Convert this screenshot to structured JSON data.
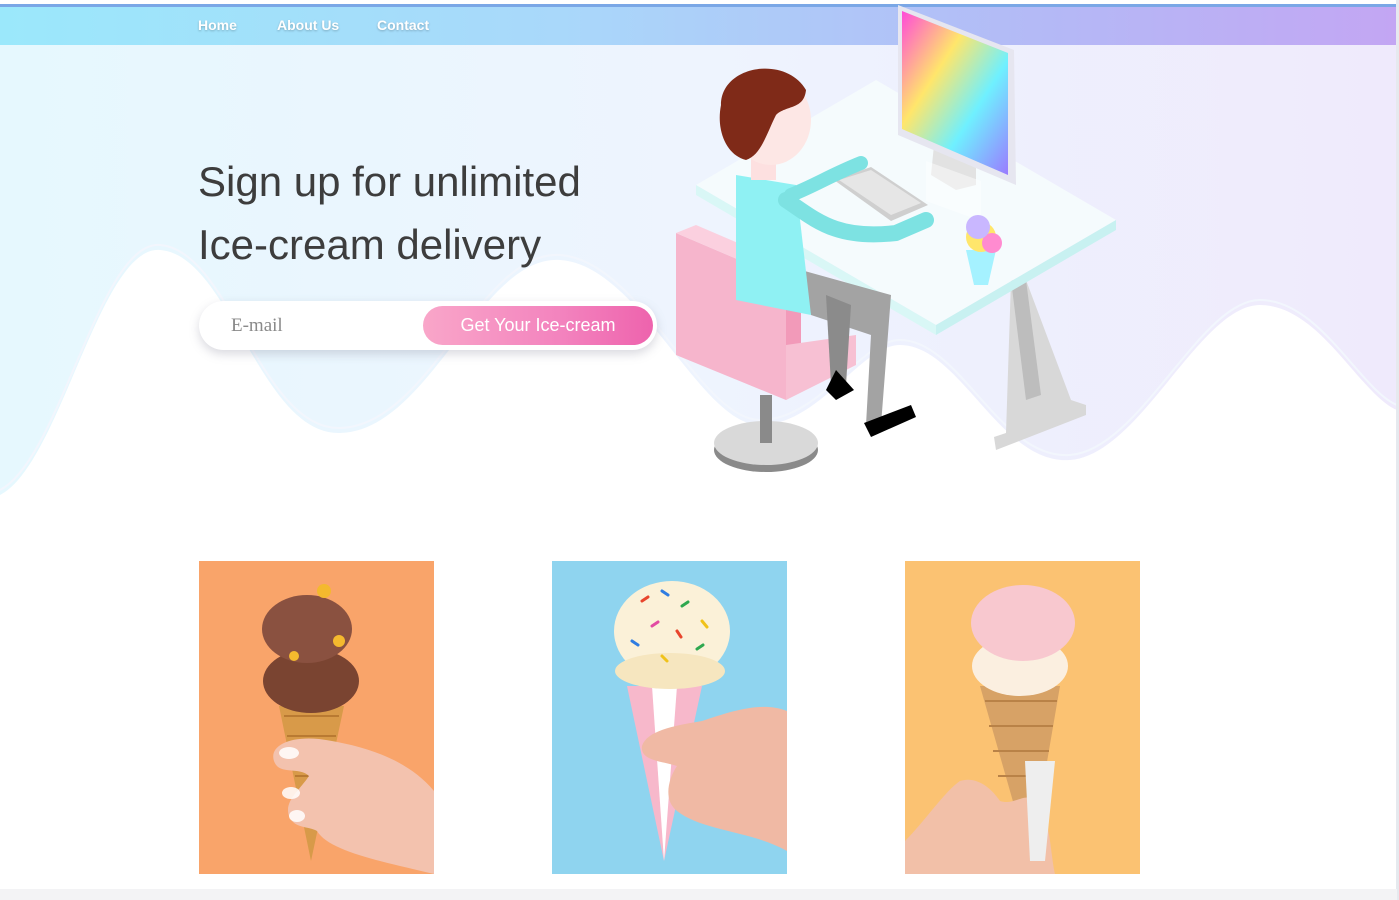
{
  "nav": {
    "items": [
      {
        "label": "Home",
        "active": true
      },
      {
        "label": "About Us",
        "active": false
      },
      {
        "label": "Contact",
        "active": false
      }
    ]
  },
  "hero": {
    "headline_line1": "Sign up for unlimited",
    "headline_line2": "Ice-cream delivery",
    "email_placeholder": "E-mail",
    "email_value": "",
    "cta_label": "Get Your Ice-cream"
  },
  "products": [
    {
      "name": "chocolate-ice-cream-cone",
      "background": "#f9a46a"
    },
    {
      "name": "sprinkles-vanilla-ice-cream-cone",
      "background": "#8fd4ef"
    },
    {
      "name": "strawberry-ice-cream-cone",
      "background": "#fbc272"
    }
  ],
  "colors": {
    "nav_gradient_start": "#9be8fb",
    "nav_gradient_end": "#c3a6f3",
    "active_indicator": "#1f55e6",
    "cta_gradient_start": "#f9a6c9",
    "cta_gradient_end": "#ee63ad",
    "headline_text": "#3d3d3d"
  }
}
